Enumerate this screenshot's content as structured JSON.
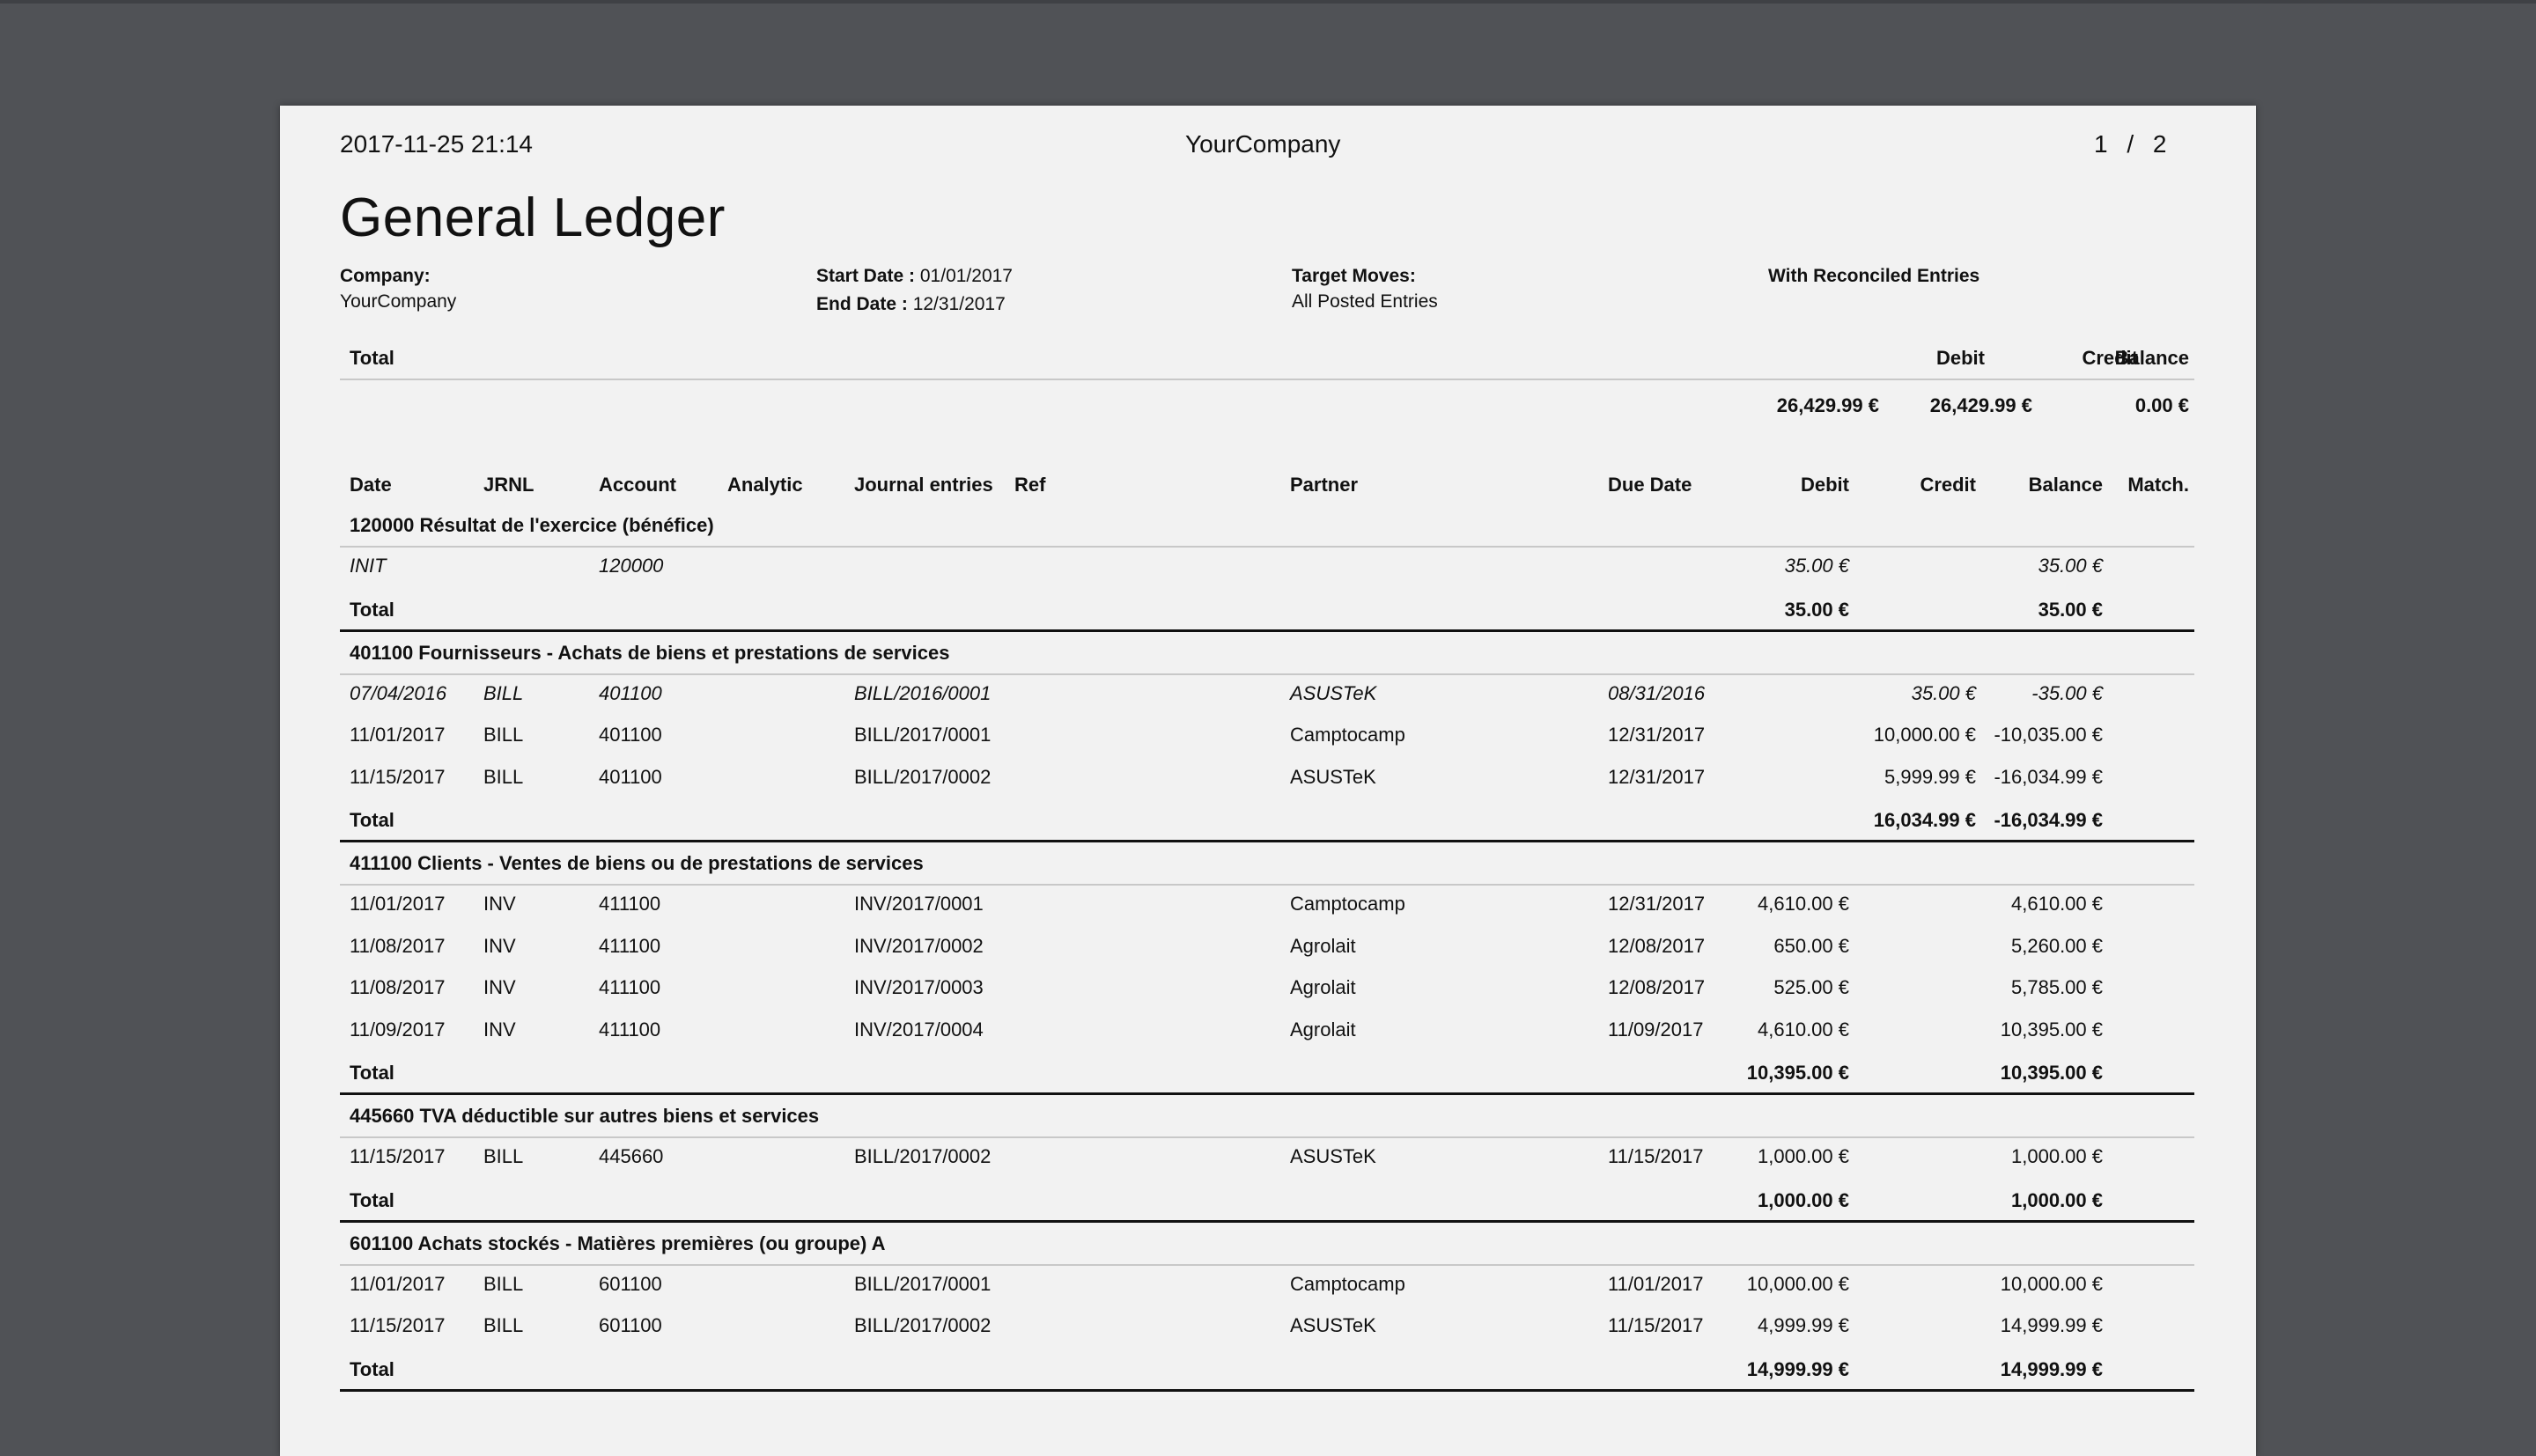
{
  "header": {
    "datetime": "2017-11-25 21:14",
    "company": "YourCompany",
    "page_current": "1",
    "page_sep": "/",
    "page_total": "2"
  },
  "title": "General Ledger",
  "meta": {
    "company_label": "Company:",
    "company_value": "YourCompany",
    "start_label": "Start Date :",
    "start_value": "01/01/2017",
    "end_label": "End Date :",
    "end_value": "12/31/2017",
    "target_label": "Target Moves:",
    "target_value": "All Posted Entries",
    "reconciled_label": "With Reconciled Entries"
  },
  "summary": {
    "total_label": "Total",
    "debit_label": "Debit",
    "credit_label": "Credit",
    "balance_label": "Balance",
    "debit": "26,429.99 €",
    "credit": "26,429.99 €",
    "balance": "0.00 €"
  },
  "columns": {
    "date": "Date",
    "jrnl": "JRNL",
    "account": "Account",
    "analytic": "Analytic",
    "journal_entries": "Journal entries",
    "ref": "Ref",
    "partner": "Partner",
    "due_date": "Due Date",
    "debit": "Debit",
    "credit": "Credit",
    "balance": "Balance",
    "match": "Match."
  },
  "accounts": [
    {
      "title": "120000 Résultat de l'exercice (bénéfice)",
      "rows": [
        {
          "date": "INIT",
          "jrnl": "",
          "account": "120000",
          "entry": "",
          "partner": "",
          "due": "",
          "debit": "35.00 €",
          "credit": "",
          "balance": "35.00 €",
          "italic": true
        }
      ],
      "total": {
        "label": "Total",
        "debit": "35.00 €",
        "credit": "",
        "balance": "35.00 €"
      }
    },
    {
      "title": "401100 Fournisseurs - Achats de biens et prestations de services",
      "rows": [
        {
          "date": "07/04/2016",
          "jrnl": "BILL",
          "account": "401100",
          "entry": "BILL/2016/0001",
          "partner": "ASUSTeK",
          "due": "08/31/2016",
          "debit": "",
          "credit": "35.00 €",
          "balance": "-35.00 €",
          "italic": true
        },
        {
          "date": "11/01/2017",
          "jrnl": "BILL",
          "account": "401100",
          "entry": "BILL/2017/0001",
          "partner": "Camptocamp",
          "due": "12/31/2017",
          "debit": "",
          "credit": "10,000.00 €",
          "balance": "-10,035.00 €",
          "italic": false
        },
        {
          "date": "11/15/2017",
          "jrnl": "BILL",
          "account": "401100",
          "entry": "BILL/2017/0002",
          "partner": "ASUSTeK",
          "due": "12/31/2017",
          "debit": "",
          "credit": "5,999.99 €",
          "balance": "-16,034.99 €",
          "italic": false
        }
      ],
      "total": {
        "label": "Total",
        "debit": "",
        "credit": "16,034.99 €",
        "balance": "-16,034.99 €"
      }
    },
    {
      "title": "411100 Clients - Ventes de biens ou de prestations de services",
      "rows": [
        {
          "date": "11/01/2017",
          "jrnl": "INV",
          "account": "411100",
          "entry": "INV/2017/0001",
          "partner": "Camptocamp",
          "due": "12/31/2017",
          "debit": "4,610.00 €",
          "credit": "",
          "balance": "4,610.00 €",
          "italic": false
        },
        {
          "date": "11/08/2017",
          "jrnl": "INV",
          "account": "411100",
          "entry": "INV/2017/0002",
          "partner": "Agrolait",
          "due": "12/08/2017",
          "debit": "650.00 €",
          "credit": "",
          "balance": "5,260.00 €",
          "italic": false
        },
        {
          "date": "11/08/2017",
          "jrnl": "INV",
          "account": "411100",
          "entry": "INV/2017/0003",
          "partner": "Agrolait",
          "due": "12/08/2017",
          "debit": "525.00 €",
          "credit": "",
          "balance": "5,785.00 €",
          "italic": false
        },
        {
          "date": "11/09/2017",
          "jrnl": "INV",
          "account": "411100",
          "entry": "INV/2017/0004",
          "partner": "Agrolait",
          "due": "11/09/2017",
          "debit": "4,610.00 €",
          "credit": "",
          "balance": "10,395.00 €",
          "italic": false
        }
      ],
      "total": {
        "label": "Total",
        "debit": "10,395.00 €",
        "credit": "",
        "balance": "10,395.00 €"
      }
    },
    {
      "title": "445660 TVA déductible sur autres biens et services",
      "rows": [
        {
          "date": "11/15/2017",
          "jrnl": "BILL",
          "account": "445660",
          "entry": "BILL/2017/0002",
          "partner": "ASUSTeK",
          "due": "11/15/2017",
          "debit": "1,000.00 €",
          "credit": "",
          "balance": "1,000.00 €",
          "italic": false
        }
      ],
      "total": {
        "label": "Total",
        "debit": "1,000.00 €",
        "credit": "",
        "balance": "1,000.00 €"
      }
    },
    {
      "title": "601100 Achats stockés - Matières premières (ou groupe) A",
      "rows": [
        {
          "date": "11/01/2017",
          "jrnl": "BILL",
          "account": "601100",
          "entry": "BILL/2017/0001",
          "partner": "Camptocamp",
          "due": "11/01/2017",
          "debit": "10,000.00 €",
          "credit": "",
          "balance": "10,000.00 €",
          "italic": false
        },
        {
          "date": "11/15/2017",
          "jrnl": "BILL",
          "account": "601100",
          "entry": "BILL/2017/0002",
          "partner": "ASUSTeK",
          "due": "11/15/2017",
          "debit": "4,999.99 €",
          "credit": "",
          "balance": "14,999.99 €",
          "italic": false
        }
      ],
      "total": {
        "label": "Total",
        "debit": "14,999.99 €",
        "credit": "",
        "balance": "14,999.99 €"
      }
    }
  ]
}
